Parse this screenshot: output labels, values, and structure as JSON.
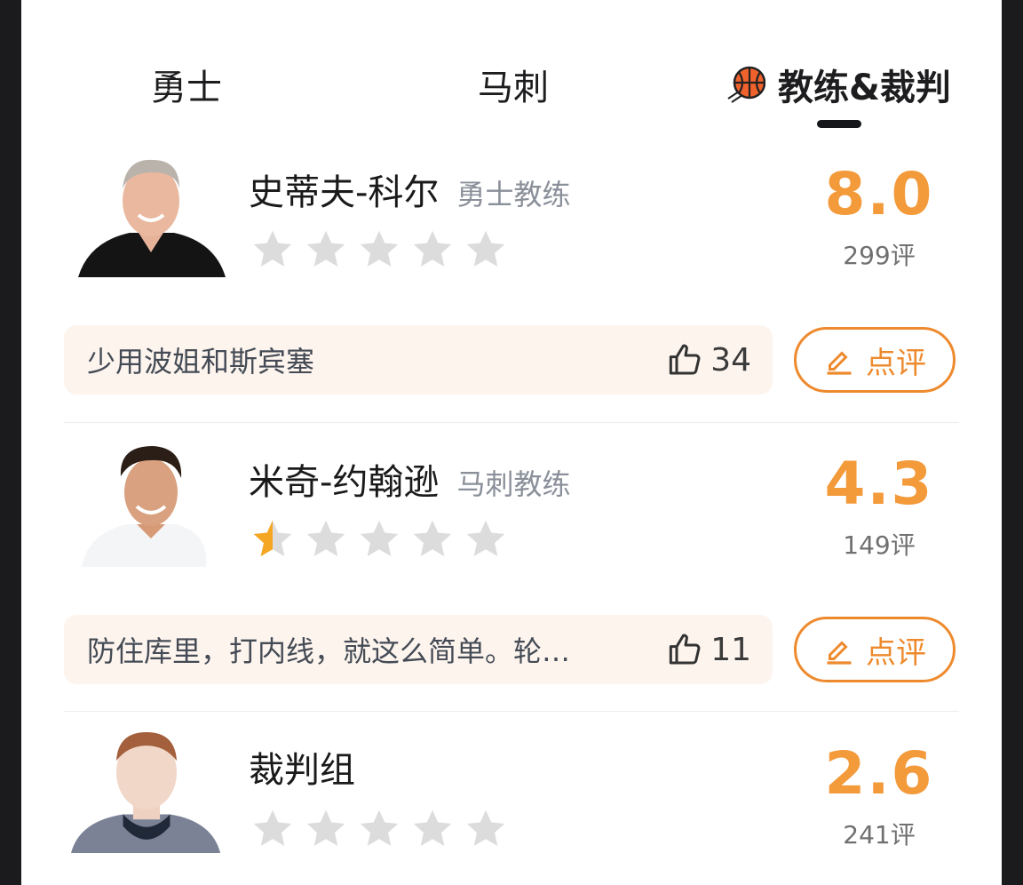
{
  "tabs": {
    "team1": "勇士",
    "team2": "马刺",
    "active": "教练&裁判"
  },
  "entries": [
    {
      "name": "史蒂夫-科尔",
      "role": "勇士教练",
      "score": "8.0",
      "count": "299评",
      "stars_filled": 0,
      "comment": "少用波姐和斯宾塞",
      "likes": "34",
      "review_label": "点评"
    },
    {
      "name": "米奇-约翰逊",
      "role": "马刺教练",
      "score": "4.3",
      "count": "149评",
      "stars_filled": 0.5,
      "comment": "防住库里，打内线，就这么简单。轮…",
      "likes": "11",
      "review_label": "点评"
    },
    {
      "name": "裁判组",
      "role": "",
      "score": "2.6",
      "count": "241评",
      "stars_filled": 0
    }
  ],
  "colors": {
    "accent": "#f39a3a",
    "button": "#ee8a2e",
    "star_gray": "#dcdcdc",
    "star_gold": "#f5a623"
  }
}
